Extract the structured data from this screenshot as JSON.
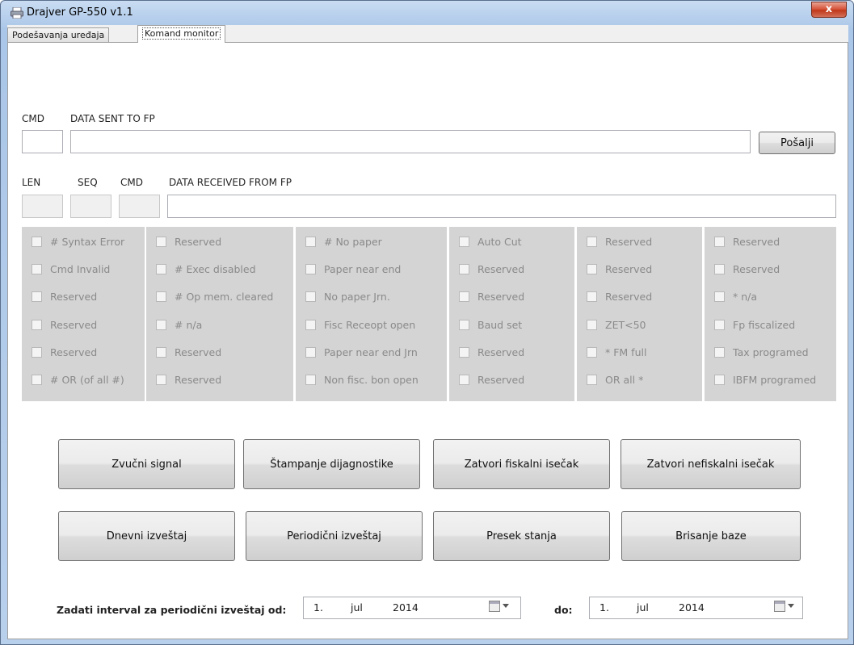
{
  "window": {
    "title": "Drajver GP-550 v1.1",
    "close": "x"
  },
  "tabs": [
    {
      "label": "Podešavanja uređaja"
    },
    {
      "label": "Komand monitor"
    }
  ],
  "sent": {
    "cmd_label": "CMD",
    "data_label": "DATA SENT TO FP",
    "cmd_value": "",
    "data_value": "",
    "send_button": "Pošalji"
  },
  "received": {
    "len_label": "LEN",
    "seq_label": "SEQ",
    "cmd_label": "CMD",
    "data_label": "DATA RECEIVED FROM FP",
    "len_value": "",
    "seq_value": "",
    "cmd_value": "",
    "data_value": ""
  },
  "status": [
    [
      "# Syntax Error",
      "Cmd Invalid",
      "Reserved",
      "Reserved",
      "Reserved",
      "# OR (of all #)"
    ],
    [
      "Reserved",
      "# Exec disabled",
      "# Op mem. cleared",
      "# n/a",
      "Reserved",
      "Reserved"
    ],
    [
      "# No paper",
      "Paper near end",
      "No paper Jrn.",
      "Fisc Receopt open",
      "Paper near end Jrn",
      "Non fisc. bon open"
    ],
    [
      "Auto Cut",
      "Reserved",
      "Reserved",
      "Baud set",
      "Reserved",
      "Reserved"
    ],
    [
      "Reserved",
      "Reserved",
      "Reserved",
      "ZET<50",
      "* FM full",
      "OR all *"
    ],
    [
      "Reserved",
      "Reserved",
      "* n/a",
      "Fp fiscalized",
      "Tax programed",
      "IBFM programed"
    ]
  ],
  "buttons": {
    "row1": [
      "Zvučni signal",
      "Štampanje dijagnostike",
      "Zatvori fiskalni isečak",
      "Zatvori nefiskalni isečak"
    ],
    "row2": [
      "Dnevni izveštaj",
      "Periodični izveštaj",
      "Presek stanja",
      "Brisanje baze"
    ]
  },
  "interval": {
    "label": "Zadati interval za periodični izveštaj od:",
    "from": {
      "day": "1.",
      "month": "jul",
      "year": "2014"
    },
    "to_label": "do:",
    "to": {
      "day": "1.",
      "month": "jul",
      "year": "2014"
    }
  },
  "icons": {
    "app": "printer-icon",
    "calendar": "calendar-dropdown-icon"
  }
}
